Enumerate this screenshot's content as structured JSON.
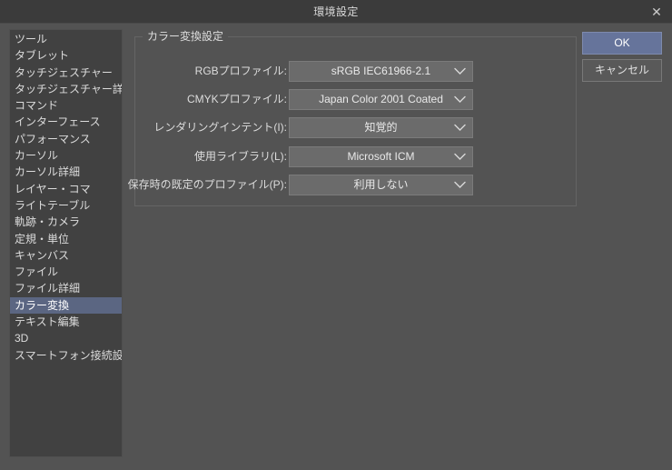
{
  "window": {
    "title": "環境設定",
    "close_icon": "close-icon",
    "close_glyph": "✕"
  },
  "sidebar": {
    "items": [
      {
        "label": "ツール",
        "selected": false
      },
      {
        "label": "タブレット",
        "selected": false
      },
      {
        "label": "タッチジェスチャー",
        "selected": false
      },
      {
        "label": "タッチジェスチャー詳細",
        "selected": false
      },
      {
        "label": "コマンド",
        "selected": false
      },
      {
        "label": "インターフェース",
        "selected": false
      },
      {
        "label": "パフォーマンス",
        "selected": false
      },
      {
        "label": "カーソル",
        "selected": false
      },
      {
        "label": "カーソル詳細",
        "selected": false
      },
      {
        "label": "レイヤー・コマ",
        "selected": false
      },
      {
        "label": "ライトテーブル",
        "selected": false
      },
      {
        "label": "軌跡・カメラ",
        "selected": false
      },
      {
        "label": "定規・単位",
        "selected": false
      },
      {
        "label": "キャンバス",
        "selected": false
      },
      {
        "label": "ファイル",
        "selected": false
      },
      {
        "label": "ファイル詳細",
        "selected": false
      },
      {
        "label": "カラー変換",
        "selected": true
      },
      {
        "label": "テキスト編集",
        "selected": false
      },
      {
        "label": "3D",
        "selected": false
      },
      {
        "label": "スマートフォン接続設定",
        "selected": false
      }
    ]
  },
  "group": {
    "legend": "カラー変換設定",
    "rows": [
      {
        "label": "RGBプロファイル:",
        "value": "sRGB IEC61966-2.1"
      },
      {
        "label": "CMYKプロファイル:",
        "value": "Japan Color 2001 Coated"
      },
      {
        "label": "レンダリングインテント(I):",
        "value": "知覚的"
      },
      {
        "label": "使用ライブラリ(L):",
        "value": "Microsoft ICM"
      },
      {
        "label": "保存時の既定のプロファイル(P):",
        "value": "利用しない"
      }
    ]
  },
  "buttons": {
    "ok": "OK",
    "cancel": "キャンセル"
  },
  "colors": {
    "dialog_bg": "#535353",
    "titlebar_bg": "#3b3b3b",
    "sidebar_bg": "#414141",
    "selection": "#5b6682",
    "combo_bg": "#6b6b6b",
    "ok_button": "#66749b",
    "text": "#dcdcdc"
  }
}
